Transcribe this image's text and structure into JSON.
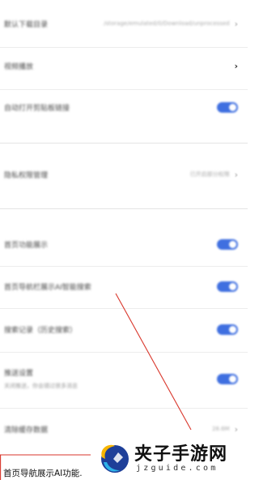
{
  "settings": {
    "row_default_search": {
      "label": "默认下载目录",
      "value": "/storage/emulated/0/Download/unprocessed"
    },
    "row_video_autoplay": {
      "label": "视频播放"
    },
    "row_auto_play": {
      "label": "自动打开剪贴板链接"
    },
    "row_permissions": {
      "label": "隐私权限管理",
      "value": "已开启部分权限"
    },
    "row_personalized": {
      "label": "首页功能展示"
    },
    "row_ai_nav": {
      "label": "首页导航栏展示AI智能搜索"
    },
    "row_search_suggest": {
      "label": "搜索记录（历史搜索）"
    },
    "row_notify": {
      "label": "推送设置",
      "sub": "关闭推送，你会错过很多消息"
    },
    "row_clear_cache": {
      "label": "清除缓存数据",
      "value": "28.6M"
    }
  },
  "caption": {
    "text": "首页导航展示AI功能."
  },
  "watermark": {
    "title": "夹子手游网",
    "url": "jzguide.com"
  },
  "colors": {
    "toggle_on": "#3f6fe0",
    "annotation": "#d9362b"
  }
}
